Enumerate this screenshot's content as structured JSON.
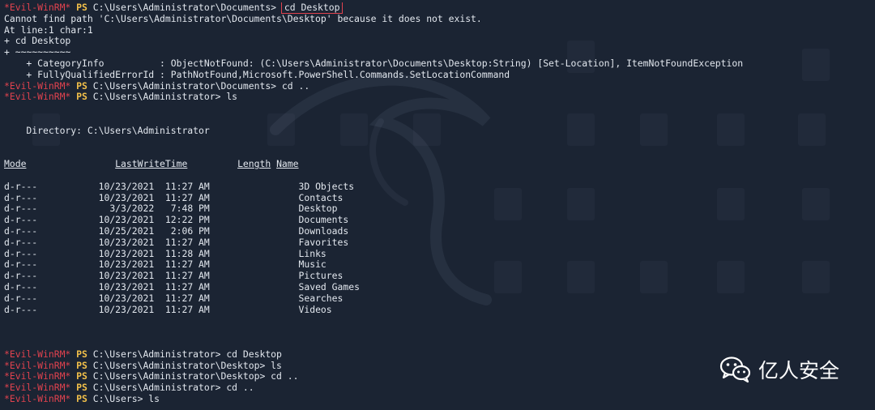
{
  "terminal": {
    "prompt_label": "*Evil-WinRM*",
    "ps_label": "PS",
    "lines": {
      "p1_path": "C:\\Users\\Administrator\\Documents>",
      "p1_cmd": "cd Desktop",
      "err1": "Cannot find path 'C:\\Users\\Administrator\\Documents\\Desktop' because it does not exist.",
      "err2": "At line:1 char:1",
      "err3": "+ cd Desktop",
      "err4": "+ ~~~~~~~~~~",
      "err5": "    + CategoryInfo          : ObjectNotFound: (C:\\Users\\Administrator\\Documents\\Desktop:String) [Set-Location], ItemNotFoundException",
      "err6": "    + FullyQualifiedErrorId : PathNotFound,Microsoft.PowerShell.Commands.SetLocationCommand",
      "p2": "C:\\Users\\Administrator\\Documents> cd ..",
      "p3": "C:\\Users\\Administrator> ls",
      "dir_header": "    Directory: C:\\Users\\Administrator"
    },
    "listing": {
      "col_mode": "Mode",
      "col_lwt": "LastWriteTime",
      "col_length": "Length",
      "col_name": "Name",
      "rows": [
        {
          "mode": "d-r---",
          "date": "10/23/2021",
          "time": "11:27 AM",
          "name": "3D Objects"
        },
        {
          "mode": "d-r---",
          "date": "10/23/2021",
          "time": "11:27 AM",
          "name": "Contacts"
        },
        {
          "mode": "d-r---",
          "date": "3/3/2022",
          "time": "7:48 PM",
          "name": "Desktop"
        },
        {
          "mode": "d-r---",
          "date": "10/23/2021",
          "time": "12:22 PM",
          "name": "Documents"
        },
        {
          "mode": "d-r---",
          "date": "10/25/2021",
          "time": "2:06 PM",
          "name": "Downloads"
        },
        {
          "mode": "d-r---",
          "date": "10/23/2021",
          "time": "11:27 AM",
          "name": "Favorites"
        },
        {
          "mode": "d-r---",
          "date": "10/23/2021",
          "time": "11:28 AM",
          "name": "Links"
        },
        {
          "mode": "d-r---",
          "date": "10/23/2021",
          "time": "11:27 AM",
          "name": "Music"
        },
        {
          "mode": "d-r---",
          "date": "10/23/2021",
          "time": "11:27 AM",
          "name": "Pictures"
        },
        {
          "mode": "d-r---",
          "date": "10/23/2021",
          "time": "11:27 AM",
          "name": "Saved Games"
        },
        {
          "mode": "d-r---",
          "date": "10/23/2021",
          "time": "11:27 AM",
          "name": "Searches"
        },
        {
          "mode": "d-r---",
          "date": "10/23/2021",
          "time": "11:27 AM",
          "name": "Videos"
        }
      ]
    },
    "tail": [
      "C:\\Users\\Administrator> cd Desktop",
      "C:\\Users\\Administrator\\Desktop> ls",
      "C:\\Users\\Administrator\\Desktop> cd ..",
      "C:\\Users\\Administrator> cd ..",
      "C:\\Users> ls"
    ]
  },
  "badge": {
    "name": "亿人安全",
    "icon": "wechat-icon"
  },
  "colors": {
    "background": "#1b2433",
    "text": "#e2e7ee",
    "prompt": "#e0424e",
    "ps": "#f2c04a",
    "highlight_box": "#e0424e"
  }
}
